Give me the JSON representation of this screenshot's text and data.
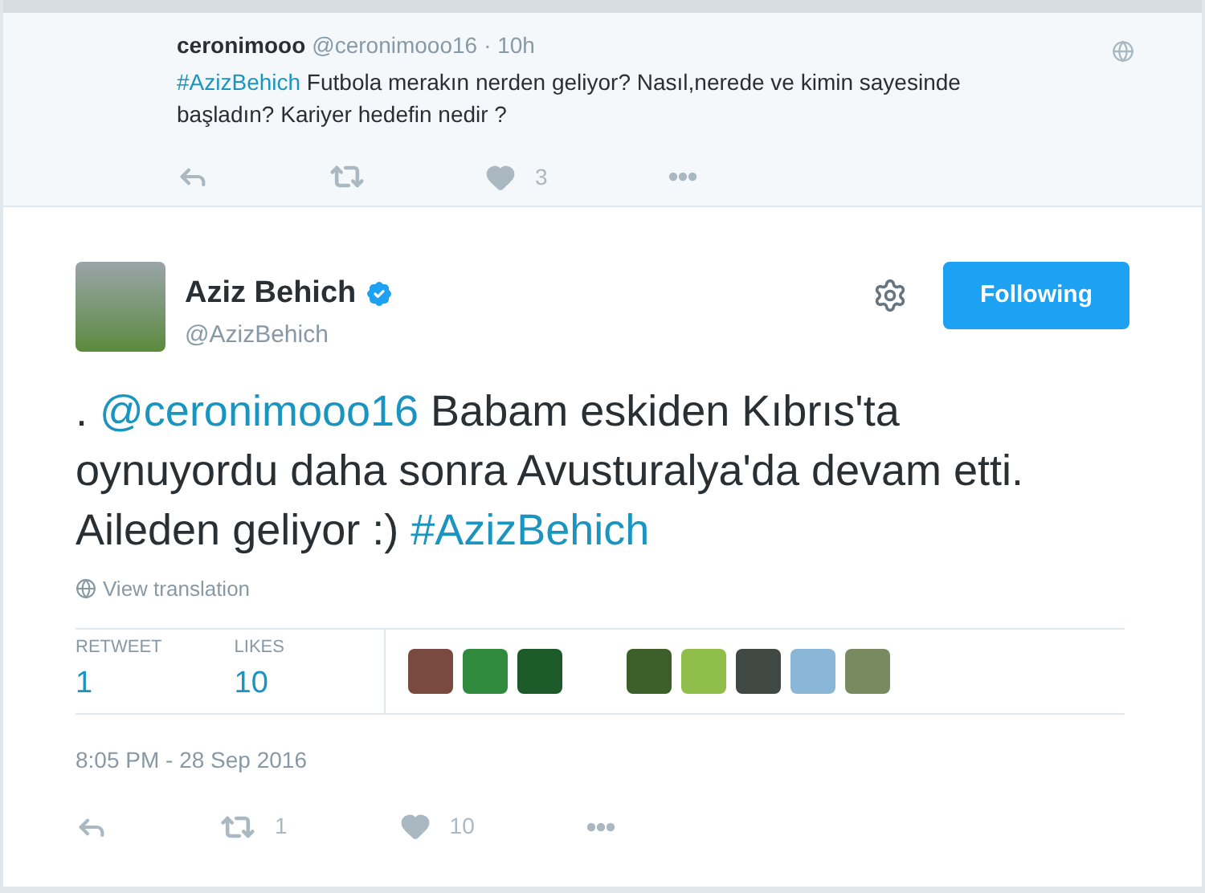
{
  "reply": {
    "name": "ceronimooo",
    "handle": "@ceronimooo16",
    "time": "· 10h",
    "hashtag": "#AzizBehich",
    "text": " Futbola merakın nerden geliyor? Nasıl,nerede ve kimin sayesinde başladın? Kariyer hedefin nedir ?",
    "likes": "3"
  },
  "tweet": {
    "name": "Aziz Behich",
    "verified": true,
    "handle": "@AzizBehich",
    "follow_label": "Following",
    "following": true,
    "parts": [
      {
        "kind": "text",
        "text": ". "
      },
      {
        "kind": "link",
        "text": "@ceronimooo16"
      },
      {
        "kind": "text",
        "text": " Babam eskiden Kıbrıs'ta oynuyordu daha sonra Avusturalya'da devam etti. Aileden geliyor :) "
      },
      {
        "kind": "link",
        "text": "#AzizBehich"
      }
    ],
    "translate": "View translation",
    "stats": [
      {
        "label": "RETWEET",
        "value": "1"
      },
      {
        "label": "LIKES",
        "value": "10"
      }
    ],
    "likers": [
      {
        "kind": "photo",
        "color": "#7a4a40"
      },
      {
        "kind": "photo",
        "color": "#2f8a3e"
      },
      {
        "kind": "photo",
        "color": "#1d5a2a"
      },
      {
        "kind": "gap"
      },
      {
        "kind": "photo",
        "color": "#3d5f2a"
      },
      {
        "kind": "photo",
        "color": "#8fbf4a"
      },
      {
        "kind": "photo",
        "color": "#404844"
      },
      {
        "kind": "photo",
        "color": "#8ab6d8"
      },
      {
        "kind": "photo",
        "color": "#7a8a60"
      }
    ],
    "date": "8:05 PM - 28 Sep 2016",
    "retweets": "1",
    "likes": "10"
  }
}
